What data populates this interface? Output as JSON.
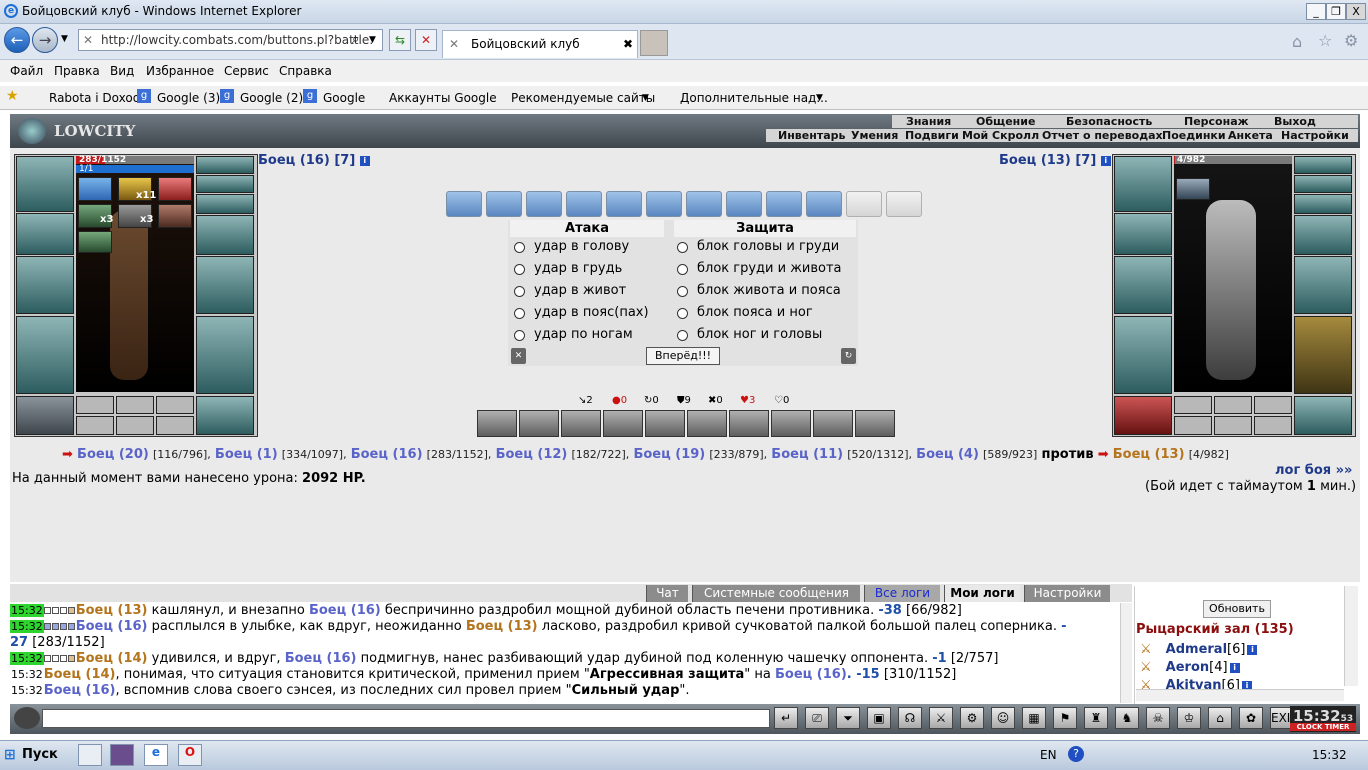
{
  "window": {
    "title": "Бойцовский клуб - Windows Internet Explorer",
    "min": "_",
    "max": "❐",
    "close": "X"
  },
  "nav": {
    "url": "http://lowcity.combats.com/buttons.pl?battle:",
    "tab_title": "Бойцовский клуб",
    "tab_close": "✖"
  },
  "menu": [
    "Файл",
    "Правка",
    "Вид",
    "Избранное",
    "Сервис",
    "Справка"
  ],
  "favorites": [
    "Rabota i Doxod",
    "Google (3)",
    "Google (2)",
    "Google",
    "Аккаунты Google",
    "Рекомендуемые сайты",
    "Дополнительные над..."
  ],
  "game_menu": {
    "top": [
      "Знания",
      "Общение",
      "Безопасность",
      "Персонаж",
      "Выход"
    ],
    "bottom": [
      "Инвентарь",
      "Умения",
      "Подвиги",
      "Мой Скролл",
      "Отчет о переводах",
      "Поединки",
      "Анкета",
      "Настройки"
    ]
  },
  "logo": "LOWCITY",
  "player": {
    "name": "Боец (16)",
    "level": "[7]",
    "hp": "283/1152",
    "hp_fraction": 0.246,
    "mana": "1/1",
    "buff_x11": "x11",
    "buff_x3a": "x3",
    "buff_x3b": "x3"
  },
  "enemy": {
    "name": "Боец (13)",
    "level": "[7]",
    "hp": "4/982",
    "hp_fraction": 0.004
  },
  "scrolls": {
    "filled": 10,
    "empty": 2
  },
  "attack": {
    "title": "Атака",
    "options": [
      "удар в голову",
      "удар в грудь",
      "удар в живот",
      "удар в пояс(пах)",
      "удар по ногам"
    ]
  },
  "defense": {
    "title": "Защита",
    "options": [
      "блок головы и груди",
      "блок груди и живота",
      "блок живота и пояса",
      "блок пояса и ног",
      "блок ног и головы"
    ]
  },
  "go_button": "Вперёд!!!",
  "counters": [
    "↘2",
    "●0",
    "↻0",
    "⛊9",
    "✖0",
    "♥3",
    "♡0"
  ],
  "team1": [
    {
      "name": "Боец (20)",
      "hp": "[116/796]"
    },
    {
      "name": "Боец (1)",
      "hp": "[334/1097]"
    },
    {
      "name": "Боец (16)",
      "hp": "[283/1152]"
    },
    {
      "name": "Боец (12)",
      "hp": "[182/722]"
    },
    {
      "name": "Боец (19)",
      "hp": "[233/879]"
    },
    {
      "name": "Боец (11)",
      "hp": "[520/1312]"
    },
    {
      "name": "Боец (4)",
      "hp": "[589/923]"
    }
  ],
  "vs": "против",
  "team2": {
    "name": "Боец (13)",
    "hp": "[4/982]"
  },
  "damage": {
    "prefix": "На данный момент вами нанесено урона:",
    "value": "2092 HP."
  },
  "log_link": "лог боя »»",
  "timeout": {
    "a": "(Бой идет с таймаутом",
    "b": "1",
    "c": "мин.)"
  },
  "log_tabs": [
    "Чат",
    "Системные сообщения",
    "Все логи",
    "Мои логи",
    "Настройки"
  ],
  "log": [
    {
      "t": "15:32",
      "a": "Боец (13)",
      "x1": " кашлянул, и внезапно ",
      "b": "Боец (16)",
      "x2": " беспричинно раздробил мощной дубиной область печени противника. ",
      "d": "-38",
      "h": " [66/982]"
    },
    {
      "t": "15:32",
      "a": "Боец (16)",
      "x1": " расплылся в улыбке, как вдруг, неожиданно ",
      "b": "Боец (13)",
      "x2": " ласково, раздробил кривой сучковатой палкой большой палец соперника. ",
      "d": "-",
      "d2": "27",
      "h": " [283/1152]"
    },
    {
      "t": "15:32",
      "a": "Боец (14)",
      "x1": " удивился, и вдруг, ",
      "b": "Боец (16)",
      "x2": " подмигнув, нанес разбивающий удар дубиной под коленную чашечку оппонента. ",
      "d": "-1",
      "h": " [2/757]"
    },
    {
      "t": "15:32",
      "a": "Боец (14)",
      "x1": ", понимая, что ситуация становится критической, применил прием \"",
      "s": "Агрессивная защита",
      "x2": "\" на ",
      "b": "Боец (16)",
      "d": ". -15",
      "h": " [310/1152]"
    },
    {
      "t": "15:32",
      "a": "Боец (16)",
      "x1": ", вспомнив слова своего сэнсея, из последних сил провел прием \"",
      "s": "Сильный удар",
      "x2": "\"."
    }
  ],
  "room": {
    "refresh": "Обновить",
    "title": "Рыцарский зал (135)",
    "users": [
      {
        "name": "Admeral",
        "lvl": "[6]"
      },
      {
        "name": "Aeron",
        "lvl": "[4]"
      },
      {
        "name": "Akitvan",
        "lvl": "[6]"
      }
    ]
  },
  "clock": {
    "time": "15:32",
    "sec": "53",
    "labels": "CLOCK TIMER"
  },
  "taskbar": {
    "start": "Пуск",
    "lang": "EN",
    "time": "15:32"
  }
}
